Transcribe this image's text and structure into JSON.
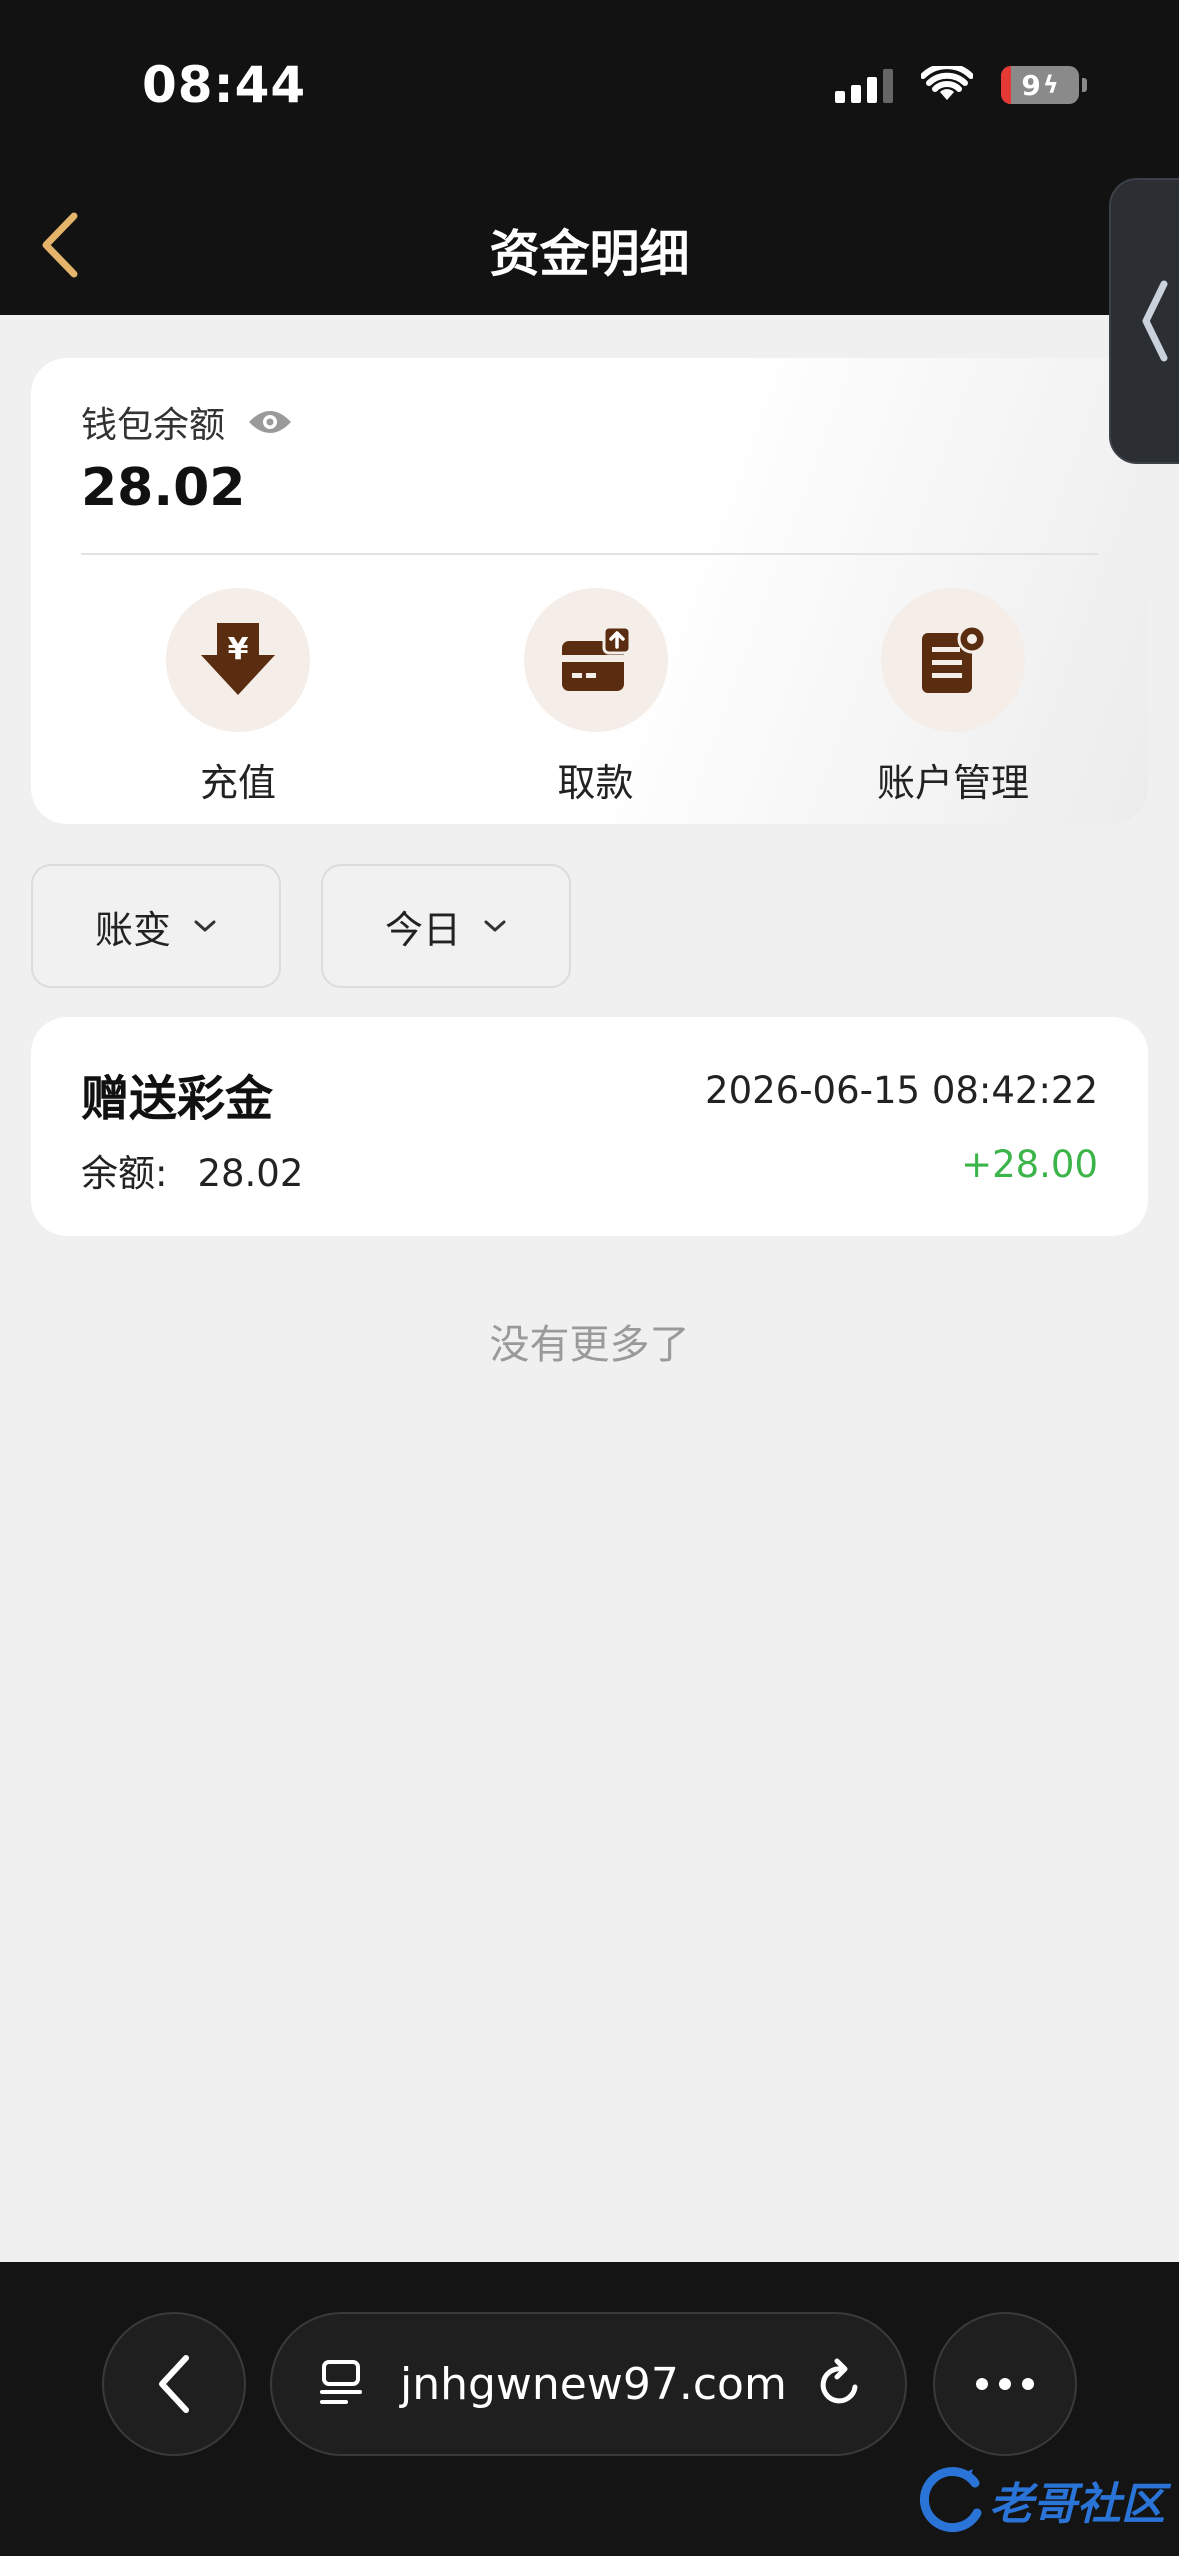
{
  "status_bar": {
    "time": "08:44",
    "battery": "9"
  },
  "header": {
    "title": "资金明细"
  },
  "wallet": {
    "label": "钱包余额",
    "balance": "28.02",
    "actions": [
      {
        "label": "充值",
        "icon": "deposit-icon"
      },
      {
        "label": "取款",
        "icon": "withdraw-icon"
      },
      {
        "label": "账户管理",
        "icon": "account-manage-icon"
      }
    ]
  },
  "filters": {
    "type_label": "账变",
    "date_label": "今日"
  },
  "records": [
    {
      "title": "赠送彩金",
      "time": "2026-06-15 08:42:22",
      "balance_label": "余额:",
      "balance": "28.02",
      "amount": "+28.00"
    }
  ],
  "no_more": "没有更多了",
  "browser": {
    "url": "jnhgwnew97.com"
  },
  "watermark": "老哥社区",
  "colors": {
    "accent_gold": "#e3b46a",
    "icon_brown": "#5a2d10",
    "positive": "#3bb44a"
  }
}
